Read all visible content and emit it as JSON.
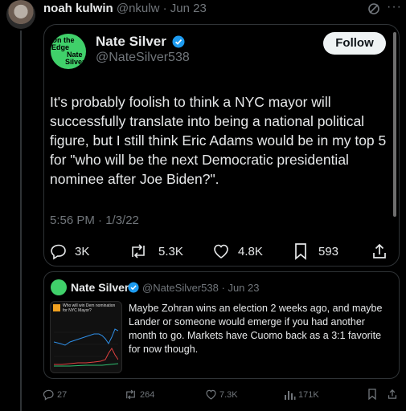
{
  "post": {
    "author_name": "noah kulwin",
    "handle": "@nkulw",
    "date": "Jun 23"
  },
  "quoted": {
    "avatar_text": [
      "On the",
      "Edge",
      "Nate",
      "Silver"
    ],
    "author_name": "Nate Silver",
    "handle": "@NateSilver538",
    "follow_label": "Follow",
    "text": "It's probably foolish to think a NYC mayor will successfully translate into being a national political figure, but I still think Eric Adams would be in my top 5 for \"who will be the next Democratic presidential nominee after Joe Biden?\".",
    "timestamp": "5:56 PM · 1/3/22",
    "stats": {
      "replies": "3K",
      "reposts": "5.3K",
      "likes": "4.8K",
      "bookmarks": "593"
    }
  },
  "inner_quote": {
    "author_name": "Nate Silver",
    "handle": "@NateSilver538",
    "date": "Jun 23",
    "thumb_title": "Who will win Dem nomination for NYC Mayor?",
    "text": "Maybe Zohran wins an election 2 weeks ago, and maybe Lander or someone would emerge if you had another month to go. Markets have Cuomo back as a 3:1 favorite for now though."
  },
  "actions": {
    "replies": "27",
    "reposts": "264",
    "likes": "7.3K",
    "views": "171K"
  },
  "colors": {
    "follow_bg": "#eff3f4",
    "verified": "#1d9bf0",
    "logo_green": "#40d06a"
  }
}
